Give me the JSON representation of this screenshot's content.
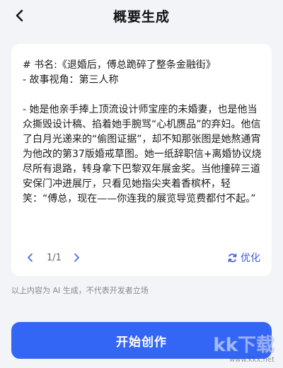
{
  "header": {
    "title": "概要生成",
    "back_icon": "chevron-left-icon"
  },
  "summary": {
    "content": "# 书名:《退婚后，傅总跪碎了整条金融街》\n- 故事视角：第三人称\n\n- 她是他亲手捧上顶流设计师宝座的未婚妻，也是他当众撕毁设计稿、掐着她手腕骂“心机赝品”的弃妇。他信了白月光递来的“偷图证据”，却不知那张图是她熬通宵为他改的第37版婚戒草图。她一纸辞职信+离婚协议烧尽所有退路，转身拿下巴黎双年展金奖。当他撞碎三道安保门冲进展厅，只看见她指尖夹着香槟杯，轻笑：“傅总，现在——你连我的展览导览费都付不起。”"
  },
  "pager": {
    "text": "1/1",
    "prev_icon": "chevron-left-icon",
    "next_icon": "chevron-right-icon"
  },
  "optimize": {
    "label": "优化",
    "icon": "refresh-icon"
  },
  "disclaimer": "以上内容为 AI 生成，不代表开发者立场",
  "start_button": {
    "label": "开始创作"
  },
  "watermark": {
    "logo": "kk下载",
    "url": "www.kkx.net"
  },
  "colors": {
    "accent": "#3466f5",
    "optimize": "#3a5bd9",
    "background": "#f3f4f7"
  }
}
